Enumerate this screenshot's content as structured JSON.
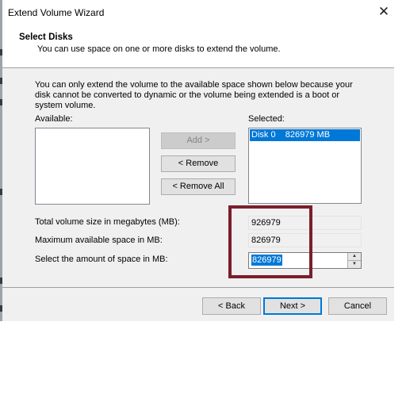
{
  "window": {
    "title": "Extend Volume Wizard",
    "close_glyph": "✕"
  },
  "header": {
    "title": "Select Disks",
    "subtitle": "You can use space on one or more disks to extend the volume."
  },
  "description": "You can only extend the volume to the available space shown below because your disk cannot be converted to dynamic or the volume being extended is a boot or system volume.",
  "available": {
    "label": "Available:",
    "items": []
  },
  "selected": {
    "label": "Selected:",
    "items": [
      {
        "disk": "Disk 0",
        "size": "826979 MB"
      }
    ]
  },
  "buttons": {
    "add": "Add >",
    "remove": "< Remove",
    "remove_all": "< Remove All",
    "back": "< Back",
    "next": "Next >",
    "cancel": "Cancel"
  },
  "fields": {
    "total_label": "Total volume size in megabytes (MB):",
    "total_value": "926979",
    "max_label": "Maximum available space in MB:",
    "max_value": "826979",
    "amount_label": "Select the amount of space in MB:",
    "amount_value": "826979"
  },
  "annotation": {
    "color": "#7a1e2c"
  }
}
